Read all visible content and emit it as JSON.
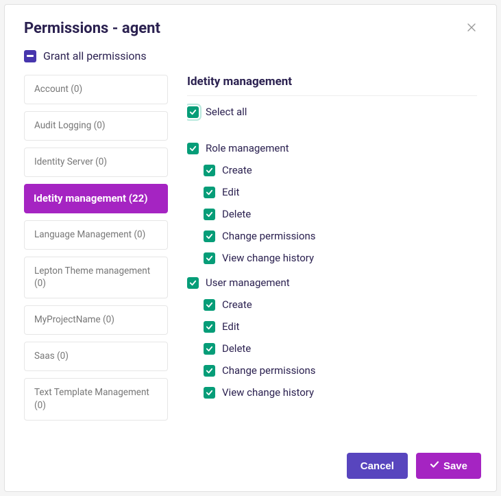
{
  "header": {
    "title": "Permissions - agent"
  },
  "grantAll": {
    "label": "Grant all permissions"
  },
  "sidebar": {
    "items": [
      {
        "label": "Account (0)",
        "active": false
      },
      {
        "label": "Audit Logging (0)",
        "active": false
      },
      {
        "label": "Identity Server (0)",
        "active": false
      },
      {
        "label": "Idetity management (22)",
        "active": true
      },
      {
        "label": "Language Management (0)",
        "active": false
      },
      {
        "label": "Lepton Theme management (0)",
        "active": false
      },
      {
        "label": "MyProjectName (0)",
        "active": false
      },
      {
        "label": "Saas (0)",
        "active": false
      },
      {
        "label": "Text Template Management (0)",
        "active": false
      }
    ]
  },
  "panel": {
    "title": "Idetity management",
    "selectAll": "Select all",
    "groups": [
      {
        "label": "Role management",
        "children": [
          "Create",
          "Edit",
          "Delete",
          "Change permissions",
          "View change history"
        ]
      },
      {
        "label": "User management",
        "children": [
          "Create",
          "Edit",
          "Delete",
          "Change permissions",
          "View change history"
        ]
      }
    ]
  },
  "footer": {
    "cancel": "Cancel",
    "save": "Save"
  },
  "colors": {
    "accent": "#a524c2",
    "primary": "#5845be",
    "check": "#069d78",
    "text": "#2b2150"
  }
}
